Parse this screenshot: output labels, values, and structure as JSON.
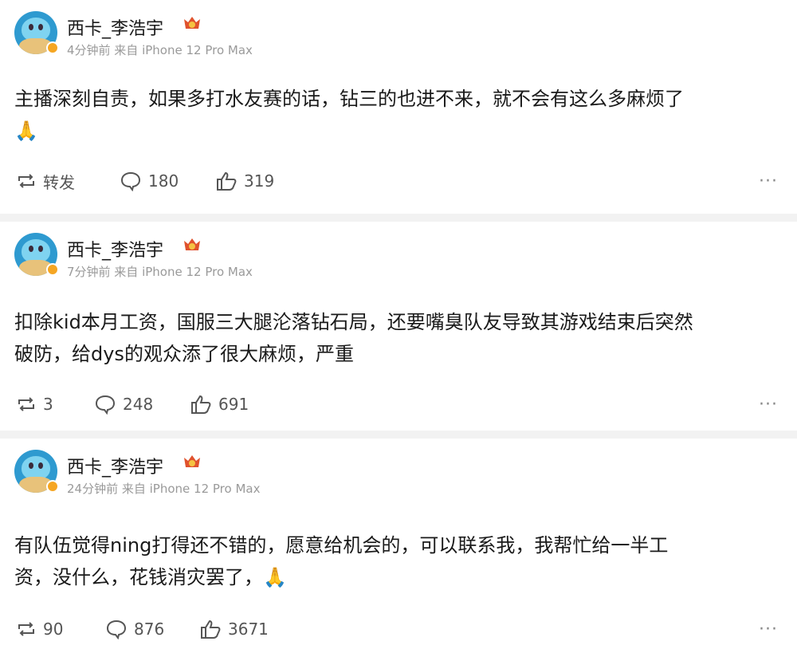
{
  "posts": [
    {
      "name": "西卡_李浩宇",
      "meta": "4分钟前 来自 iPhone 12 Pro Max",
      "text_lines": [
        "主播深刻自责，如果多打水友赛的话，钻三的也进不来，就不会有这么多麻烦了",
        "🙏"
      ],
      "repost": "转发",
      "comments": "180",
      "likes": "319"
    },
    {
      "name": "西卡_李浩宇",
      "meta": "7分钟前 来自 iPhone 12 Pro Max",
      "text_lines": [
        "扣除kid本月工资，国服三大腿沦落钻石局，还要嘴臭队友导致其游戏结束后突然",
        "破防，给dys的观众添了很大麻烦，严重"
      ],
      "repost": "3",
      "comments": "248",
      "likes": "691"
    },
    {
      "name": "西卡_李浩宇",
      "meta": "24分钟前 来自 iPhone 12 Pro Max",
      "text_lines": [
        "有队伍觉得ning打得还不错的，愿意给机会的，可以联系我，我帮忙给一半工",
        "资，没什么，花钱消灾罢了，🙏"
      ],
      "repost": "90",
      "comments": "876",
      "likes": "3671"
    }
  ],
  "more_label": "···",
  "colors": {
    "background": "#f2f2f2",
    "card": "#ffffff",
    "meta": "#9a9a9a",
    "verified": "#f5a623",
    "medal": "#e0522d"
  },
  "icons": {
    "repost": "repost-icon",
    "comment": "comment-icon",
    "like": "like-icon",
    "medal": "member-medal-icon",
    "verified": "verified-badge-icon",
    "pray": "pray-emoji"
  }
}
